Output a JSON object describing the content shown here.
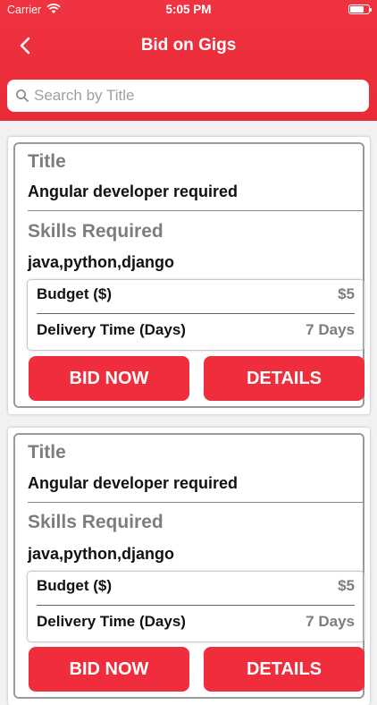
{
  "status_bar": {
    "carrier": "Carrier",
    "time": "5:05 PM"
  },
  "nav": {
    "title": "Bid on Gigs"
  },
  "search": {
    "placeholder": "Search by Title",
    "value": ""
  },
  "colors": {
    "brand_red": "#ef2d3c",
    "label_gray": "#7d7d7d"
  },
  "icons": {
    "back": "chevron-left-icon",
    "search": "magnifier-icon",
    "wifi": "wifi-icon",
    "battery": "battery-icon"
  },
  "gigs": [
    {
      "title_label": "Title",
      "title": "Angular developer required",
      "skills_label": "Skills Required",
      "skills": "java,python,django",
      "budget_label": "Budget ($)",
      "budget": "$5",
      "delivery_label": "Delivery Time (Days)",
      "delivery": "7 Days",
      "bid_label": "BID NOW",
      "details_label": "DETAILS"
    },
    {
      "title_label": "Title",
      "title": "Angular developer required",
      "skills_label": "Skills Required",
      "skills": "java,python,django",
      "budget_label": "Budget ($)",
      "budget": "$5",
      "delivery_label": "Delivery Time (Days)",
      "delivery": "7 Days",
      "bid_label": "BID NOW",
      "details_label": "DETAILS"
    }
  ]
}
